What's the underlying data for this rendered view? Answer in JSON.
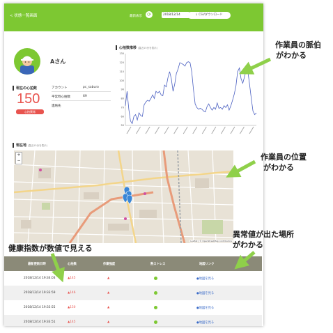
{
  "header": {
    "back_label": "< 状態一覧画面",
    "updated_label": "最新表示",
    "refresh_icon": "refresh-icon",
    "date_value": "2018/12/14",
    "csv_label": "↓ CSVダウンロード",
    "color": "#7dc832"
  },
  "profile": {
    "name": "Aさん",
    "current_hr_title": "現在の心拍数",
    "current_hr_value": "150",
    "hr_status": "心拍異常",
    "account_label": "アカウント",
    "account_value": "pc_saburo",
    "resting_label": "平常時心拍数",
    "resting_value": "69",
    "contact_label": "連絡先",
    "contact_value": ""
  },
  "chart": {
    "title": "心拍数推移",
    "subtitle": "(直近15分を表示)"
  },
  "chart_data": {
    "type": "line",
    "title": "心拍数推移",
    "ylim": [
      50,
      130
    ],
    "yticks": [
      50,
      60,
      70,
      80,
      90,
      100,
      110,
      120,
      130
    ],
    "values": [
      72,
      88,
      68,
      55,
      52,
      60,
      62,
      56,
      64,
      61,
      60,
      73,
      76,
      78,
      77,
      80,
      84,
      80,
      88,
      86,
      88,
      84,
      83,
      95,
      93,
      103,
      110,
      102,
      88,
      96,
      108,
      113,
      120,
      119,
      118,
      116,
      120,
      121,
      120,
      110,
      90,
      74,
      70,
      68,
      69,
      68,
      66,
      65,
      71,
      74,
      70,
      67,
      70,
      68,
      75,
      69,
      70,
      68,
      72,
      70,
      73,
      67,
      72,
      78,
      85,
      94,
      110,
      114,
      102,
      97,
      104,
      112,
      110,
      96,
      80,
      66,
      62,
      64
    ],
    "grid": false,
    "color": "#4a5fc1"
  },
  "location": {
    "title": "現在地",
    "subtitle": "(直近15分を表示)",
    "zoom_in": "+",
    "zoom_out": "−",
    "attribution": "Leaflet | © OpenStreetMap contributors"
  },
  "table": {
    "headers": [
      "最新更新日時",
      "心拍数",
      "作業強度",
      "熱ストレス",
      "地図リンク"
    ],
    "rows": [
      {
        "time": "2018/12/14 19:34:03",
        "hr": "▲145",
        "link": "●地図を見る"
      },
      {
        "time": "2018/12/14 19:33:59",
        "hr": "▲146",
        "link": "●地図を見る"
      },
      {
        "time": "2018/12/14 19:33:55",
        "hr": "▲150",
        "link": "●地図を見る"
      },
      {
        "time": "2018/12/14 19:33:51",
        "hr": "▲145",
        "link": "●地図を見る"
      }
    ],
    "intensity_icon": "▲",
    "heat_color": "#7dc832",
    "warn_color": "#e8534e"
  },
  "callouts": {
    "pulse": [
      "作業員の脈伯",
      "がわかる"
    ],
    "position": [
      "作業員の位置",
      "がわかる"
    ],
    "abnormal": [
      "異常値が出た場所",
      "がわかる"
    ],
    "health": "健康指数が数値で見える"
  }
}
